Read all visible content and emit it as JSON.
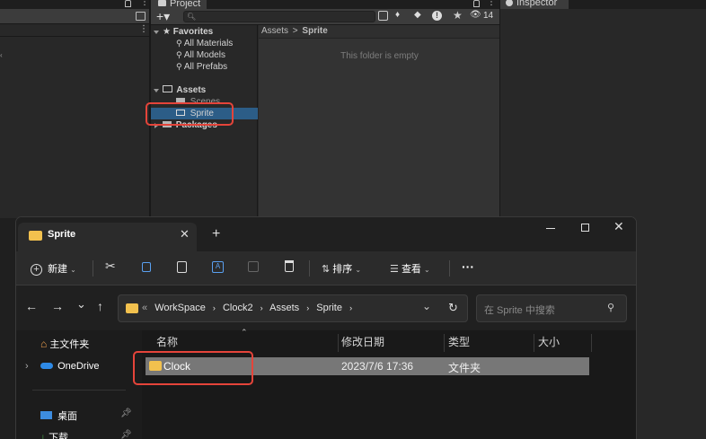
{
  "unity": {
    "project_tab": "Project",
    "inspector_tab": "Inspector",
    "filter_count": "14",
    "favorites": {
      "label": "Favorites",
      "items": [
        "All Materials",
        "All Models",
        "All Prefabs"
      ]
    },
    "assets": {
      "label": "Assets",
      "children": [
        "Scenes",
        "Sprite"
      ],
      "selected": "Sprite"
    },
    "packages_label": "Packages",
    "breadcrumb": {
      "root": "Assets",
      "separator": ">",
      "current": "Sprite"
    },
    "empty_message": "This folder is empty"
  },
  "explorer": {
    "tab_title": "Sprite",
    "new_label": "新建",
    "sort_label": "排序",
    "view_label": "查看",
    "more_label": "···",
    "address": {
      "overflow": "«",
      "segments": [
        "WorkSpace",
        "Clock2",
        "Assets",
        "Sprite"
      ]
    },
    "search_placeholder": "在 Sprite 中搜索",
    "nav_items": [
      "主文件夹",
      "OneDrive",
      "桌面",
      "下载"
    ],
    "columns": [
      "名称",
      "修改日期",
      "类型",
      "大小"
    ],
    "files": [
      {
        "name": "Clock",
        "modified": "2023/7/6 17:36",
        "type": "文件夹",
        "size": ""
      }
    ]
  },
  "colors": {
    "unity_selection": "#2c5d87",
    "highlight_box": "#e5443a",
    "folder_yellow": "#f2c14e",
    "onedrive_blue": "#2e8ae6"
  }
}
